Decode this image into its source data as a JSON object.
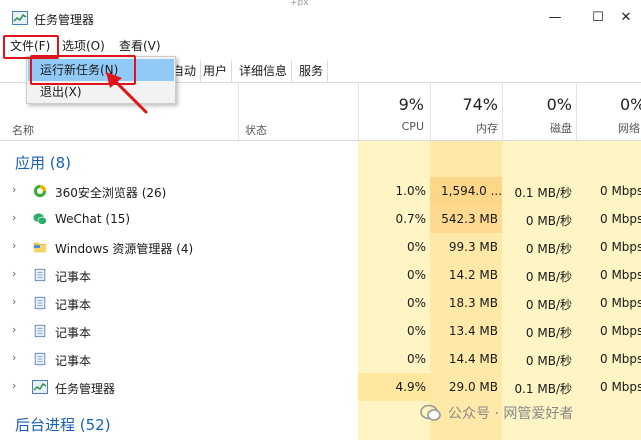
{
  "window": {
    "title": "任务管理器",
    "minimize_glyph": "—",
    "restore_glyph": "☐",
    "close_glyph": "✕",
    "background_fragment": "+px"
  },
  "menu": {
    "file": "文件(F)",
    "options": "选项(O)",
    "view": "查看(V)"
  },
  "dropdown": {
    "run_new_task": "运行新任务(N)",
    "exit": "退出(X)"
  },
  "tabs": {
    "partial_startup": "自动",
    "users": "用户",
    "details": "详细信息",
    "services": "服务"
  },
  "header": {
    "name": "名称",
    "status": "状态",
    "cpu": {
      "percent": "9%",
      "label": "CPU"
    },
    "memory": {
      "percent": "74%",
      "label": "内存"
    },
    "disk": {
      "percent": "0%",
      "label": "磁盘"
    },
    "network": {
      "percent": "0%",
      "label": "网络"
    }
  },
  "groups": {
    "apps": "应用 (8)",
    "background": "后台进程 (52)"
  },
  "processes": [
    {
      "name": "360安全浏览器 (26)",
      "icon": "browser-360-icon",
      "cpu": "1.0%",
      "memory": "1,594.0 ...",
      "disk": "0.1 MB/秒",
      "network": "0 Mbps"
    },
    {
      "name": "WeChat (15)",
      "icon": "wechat-icon",
      "cpu": "0.7%",
      "memory": "542.3 MB",
      "disk": "0 MB/秒",
      "network": "0 Mbps"
    },
    {
      "name": "Windows 资源管理器 (4)",
      "icon": "folder-icon",
      "cpu": "0%",
      "memory": "99.3 MB",
      "disk": "0 MB/秒",
      "network": "0 Mbps"
    },
    {
      "name": "记事本",
      "icon": "notepad-icon",
      "cpu": "0%",
      "memory": "14.2 MB",
      "disk": "0 MB/秒",
      "network": "0 Mbps"
    },
    {
      "name": "记事本",
      "icon": "notepad-icon",
      "cpu": "0%",
      "memory": "18.3 MB",
      "disk": "0 MB/秒",
      "network": "0 Mbps"
    },
    {
      "name": "记事本",
      "icon": "notepad-icon",
      "cpu": "0%",
      "memory": "13.4 MB",
      "disk": "0 MB/秒",
      "network": "0 Mbps"
    },
    {
      "name": "记事本",
      "icon": "notepad-icon",
      "cpu": "0%",
      "memory": "14.4 MB",
      "disk": "0 MB/秒",
      "network": "0 Mbps"
    },
    {
      "name": "任务管理器",
      "icon": "task-manager-icon",
      "cpu": "4.9%",
      "memory": "29.0 MB",
      "disk": "0.1 MB/秒",
      "network": "0 Mbps"
    }
  ],
  "watermark": {
    "text": "公众号 · 网管爱好者"
  },
  "colors": {
    "accent": "#1b5fb5",
    "highlight_box": "#e0151b",
    "menu_hover": "#91c9f7",
    "heat_light": "#fff4c4",
    "heat_medium": "#ffe9a8",
    "heat_strong": "#fcd78a"
  }
}
